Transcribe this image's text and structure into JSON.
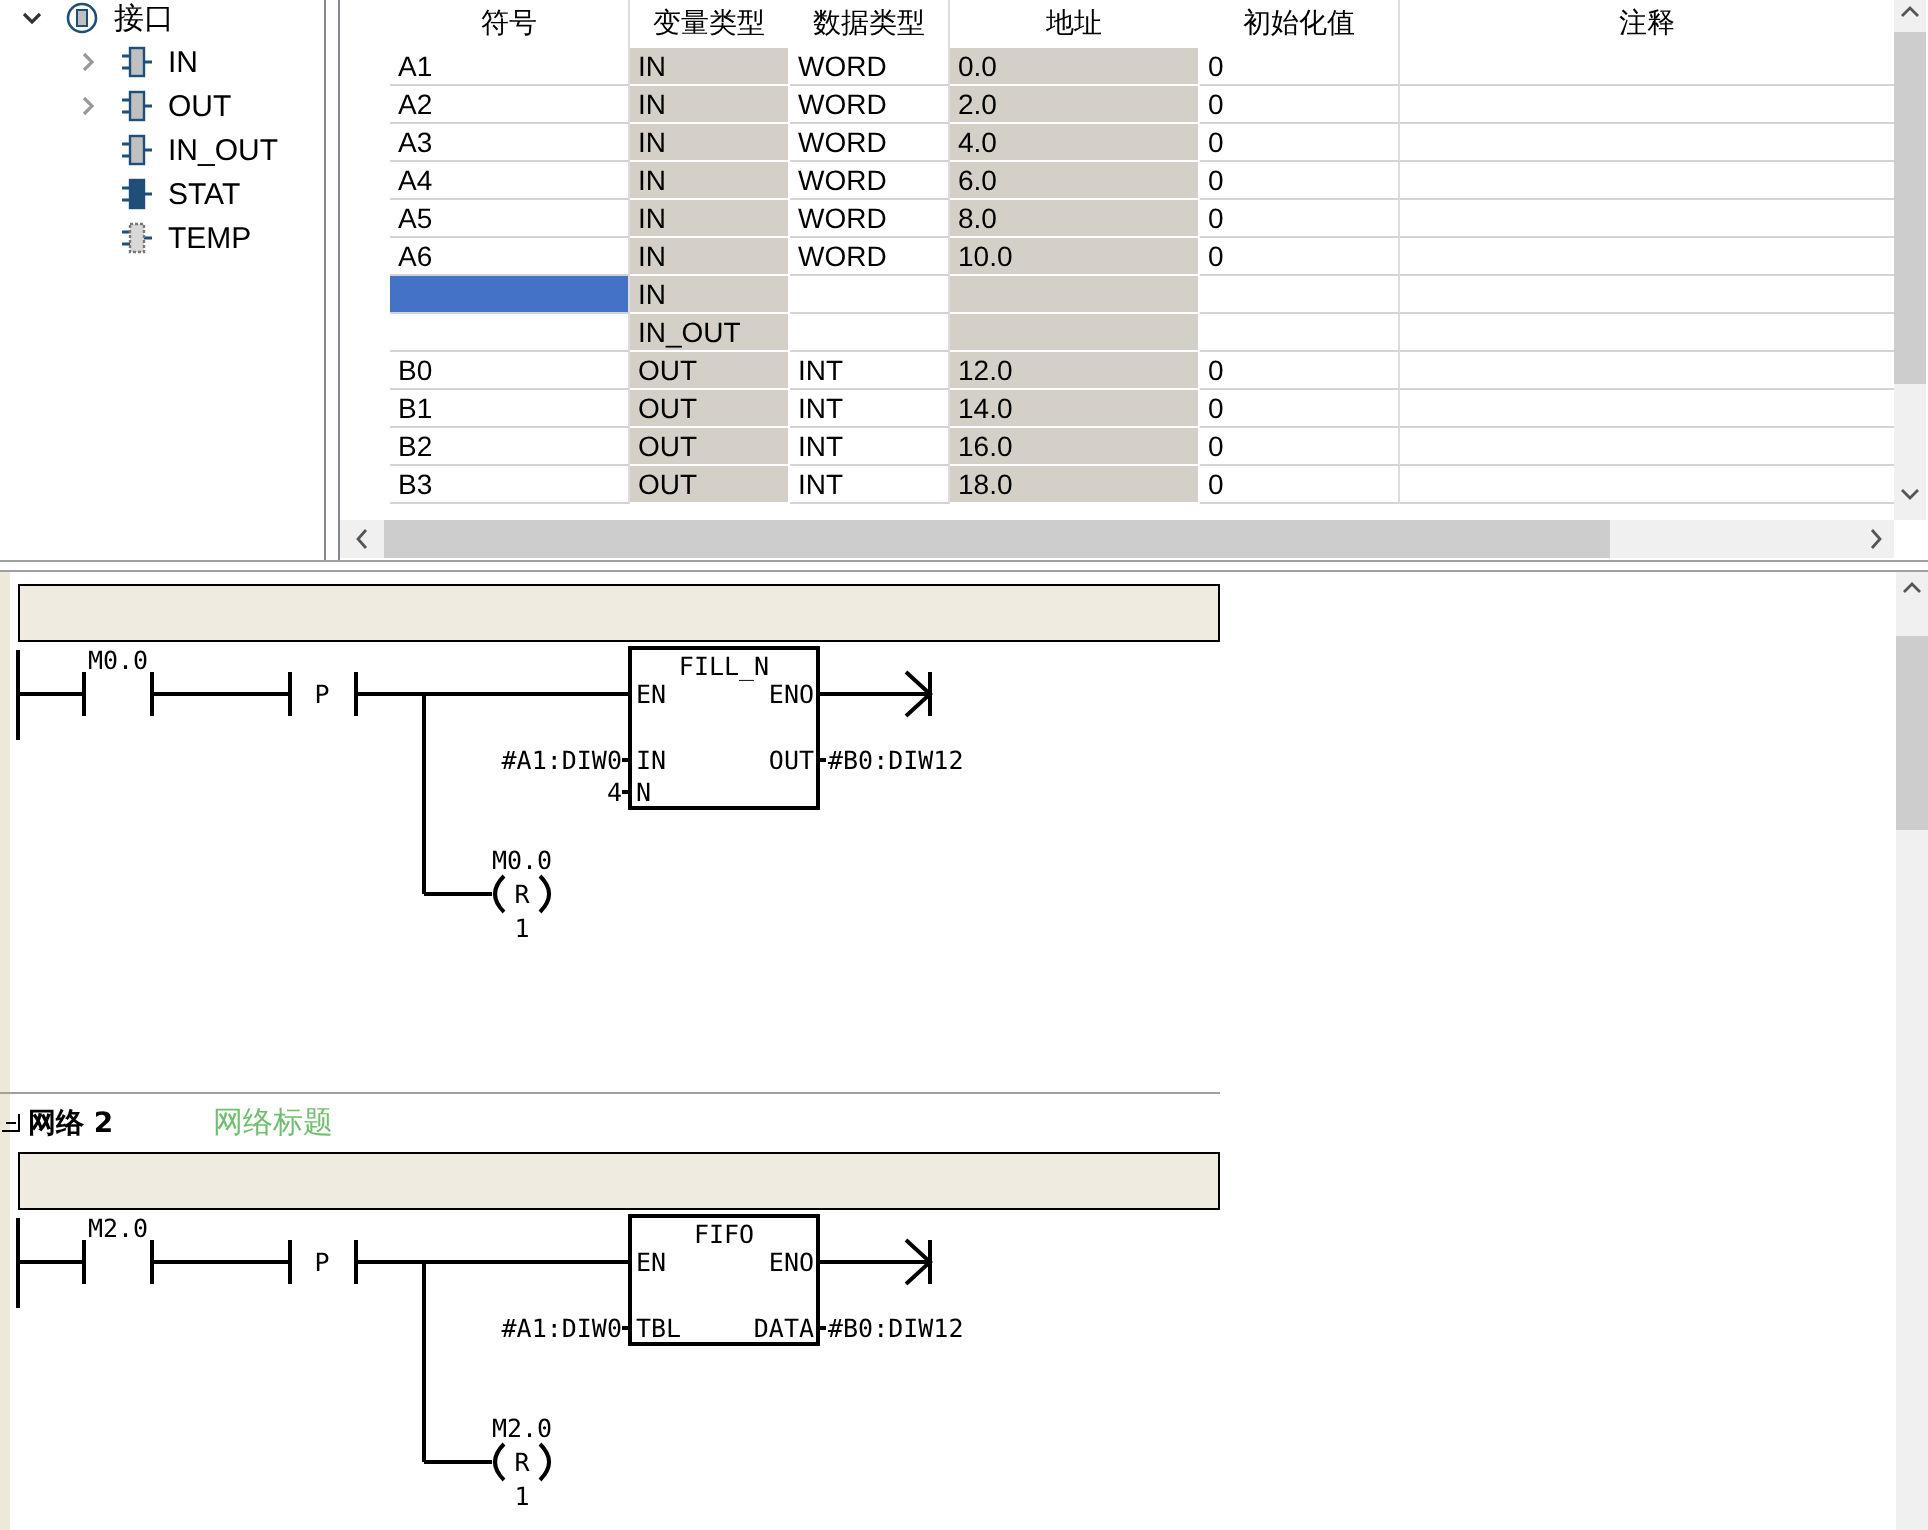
{
  "tree": {
    "label": "接口",
    "expanded": true,
    "children": [
      {
        "label": "IN",
        "kind": "port",
        "expanded": false
      },
      {
        "label": "OUT",
        "kind": "port",
        "expanded": false
      },
      {
        "label": "IN_OUT",
        "kind": "port"
      },
      {
        "label": "STAT",
        "kind": "static"
      },
      {
        "label": "TEMP",
        "kind": "temp"
      }
    ]
  },
  "table": {
    "columns": [
      {
        "label": "符号",
        "shaded": false
      },
      {
        "label": "变量类型",
        "shaded": true
      },
      {
        "label": "数据类型",
        "shaded": false
      },
      {
        "label": "地址",
        "shaded": true
      },
      {
        "label": "初始化值",
        "shaded": false
      },
      {
        "label": "注释",
        "shaded": false
      }
    ],
    "rows": [
      {
        "cells": [
          "A1",
          "IN",
          "WORD",
          "0.0",
          "0",
          ""
        ],
        "selected": false
      },
      {
        "cells": [
          "A2",
          "IN",
          "WORD",
          "2.0",
          "0",
          ""
        ],
        "selected": false
      },
      {
        "cells": [
          "A3",
          "IN",
          "WORD",
          "4.0",
          "0",
          ""
        ],
        "selected": false
      },
      {
        "cells": [
          "A4",
          "IN",
          "WORD",
          "6.0",
          "0",
          ""
        ],
        "selected": false
      },
      {
        "cells": [
          "A5",
          "IN",
          "WORD",
          "8.0",
          "0",
          ""
        ],
        "selected": false
      },
      {
        "cells": [
          "A6",
          "IN",
          "WORD",
          "10.0",
          "0",
          ""
        ],
        "selected": false
      },
      {
        "cells": [
          "",
          "IN",
          "",
          "",
          "",
          ""
        ],
        "selected": true
      },
      {
        "cells": [
          "",
          "IN_OUT",
          "",
          "",
          "",
          ""
        ],
        "selected": false
      },
      {
        "cells": [
          "B0",
          "OUT",
          "INT",
          "12.0",
          "0",
          ""
        ],
        "selected": false
      },
      {
        "cells": [
          "B1",
          "OUT",
          "INT",
          "14.0",
          "0",
          ""
        ],
        "selected": false
      },
      {
        "cells": [
          "B2",
          "OUT",
          "INT",
          "16.0",
          "0",
          ""
        ],
        "selected": false
      },
      {
        "cells": [
          "B3",
          "OUT",
          "INT",
          "18.0",
          "0",
          ""
        ],
        "selected": false
      }
    ]
  },
  "networks": [
    {
      "contact": "M0.0",
      "edge": "P",
      "block": {
        "name": "FILL_N",
        "enable_in": "EN",
        "enable_out": "ENO",
        "inputs": [
          {
            "pin": "IN",
            "operand": "#A1:DIW0"
          },
          {
            "pin": "N",
            "operand": "4"
          }
        ],
        "outputs": [
          {
            "pin": "OUT",
            "operand": "#B0:DIW12"
          }
        ]
      },
      "coil": {
        "address": "M0.0",
        "type": "R",
        "count": "1"
      }
    },
    {
      "title": "网络 2",
      "title_hint": "网络标题",
      "contact": "M2.0",
      "edge": "P",
      "block": {
        "name": "FIFO",
        "enable_in": "EN",
        "enable_out": "ENO",
        "inputs": [
          {
            "pin": "TBL",
            "operand": "#A1:DIW0"
          }
        ],
        "outputs": [
          {
            "pin": "DATA",
            "operand": "#B0:DIW12"
          }
        ]
      },
      "coil": {
        "address": "M2.0",
        "type": "R",
        "count": "1"
      }
    }
  ]
}
